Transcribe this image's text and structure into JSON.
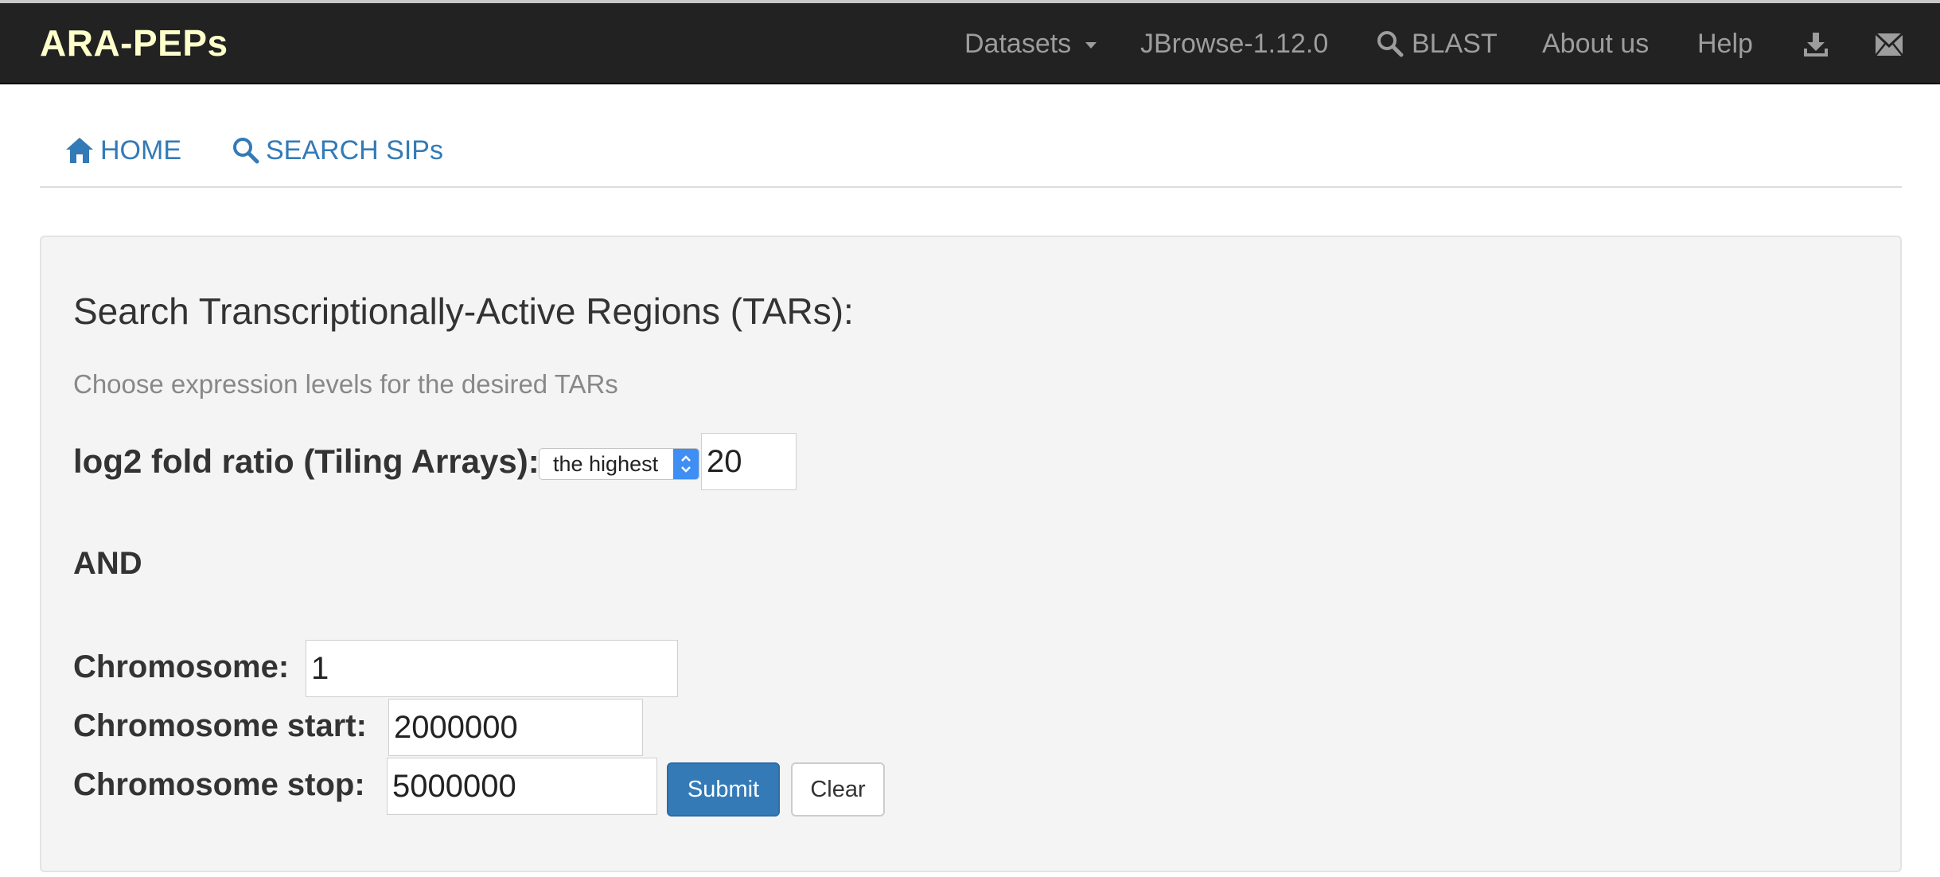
{
  "navbar": {
    "brand": "ARA-PEPs",
    "items": [
      {
        "label": "Datasets"
      },
      {
        "label": "JBrowse-1.12.0"
      },
      {
        "label": "BLAST"
      },
      {
        "label": "About us"
      },
      {
        "label": "Help"
      }
    ],
    "icons": [
      "download-icon",
      "envelope-icon"
    ]
  },
  "tabs": [
    {
      "label": "HOME",
      "icon": "home-icon"
    },
    {
      "label": "SEARCH SIPs",
      "icon": "search-icon"
    }
  ],
  "form": {
    "title": "Search Transcriptionally-Active Regions (TARs):",
    "subtitle": "Choose expression levels for the desired TARs",
    "log_label": "log2 fold ratio (Tiling Arrays):",
    "log_select_value": "the highest",
    "log_value": "20",
    "and_label": "AND",
    "chromosome_label": "Chromosome:",
    "chromosome_value": "1",
    "start_label": "Chromosome start:",
    "start_value": "2000000",
    "stop_label": "Chromosome stop:",
    "stop_value": "5000000",
    "submit_label": "Submit",
    "clear_label": "Clear"
  },
  "colors": {
    "navbar_bg": "#222222",
    "brand": "#ffffcc",
    "link": "#337ab7",
    "primary_button": "#337ab7",
    "panel_bg": "#f4f4f4"
  }
}
